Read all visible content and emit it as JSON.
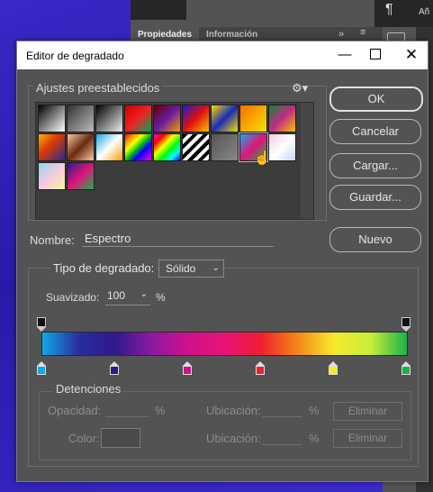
{
  "background": {
    "tabs": [
      "Propiedades",
      "Información"
    ],
    "collapse_icon": "»",
    "menu_icon": "≡",
    "pilcrow": "¶",
    "right_text": "Añ"
  },
  "dialog": {
    "title": "Editor de degradado",
    "window_controls": {
      "minimize": "—",
      "close": "✕"
    },
    "presets": {
      "label": "Ajustes preestablecidos",
      "gear_icon": "⚙▾",
      "swatches": [
        {
          "g": "linear-gradient(135deg,#000 0%,#fff 100%)"
        },
        {
          "g": "linear-gradient(135deg,#333 0%,#777 50%,#bbb 100%)"
        },
        {
          "g": "linear-gradient(135deg,#000 0%,#eee 100%)"
        },
        {
          "g": "linear-gradient(135deg,#c00 0%,#e22 50%,#0a5 100%)"
        },
        {
          "g": "linear-gradient(135deg,#600 0%,#6a1aa0 50%,#f6a000 100%)"
        },
        {
          "g": "linear-gradient(135deg,#1a1ac8 0%,#e01010 50%,#f6c400 100%)"
        },
        {
          "g": "linear-gradient(135deg,#f6e000 0%,#1a2ab8 50%,#f6e000 100%)"
        },
        {
          "g": "linear-gradient(135deg,#f67000 0%,#f6e000 100%)"
        },
        {
          "g": "linear-gradient(135deg,#0a8a2a 0%,#c02a8a 50%,#f6c400 100%)"
        },
        {
          "g": "linear-gradient(135deg,#f6b800 0%,#e03a00 40%,#2a2a8a 100%)"
        },
        {
          "g": "linear-gradient(135deg,#f6c8a0 0%,#6a2a10 50%,#f6c8a0 100%)"
        },
        {
          "g": "linear-gradient(135deg,#1aa8e8 0%,#fff 50%,#f6a000 100%)"
        },
        {
          "g": "linear-gradient(135deg,#f00 0%,#f80 16%,#ff0 33%,#0c0 50%,#00f 66%,#80f 83%,#f0f 100%)"
        },
        {
          "g": "linear-gradient(135deg,#f0f 0%,#f00 20%,#ff0 40%,#0f0 60%,#0ff 80%,#00f 100%)"
        },
        {
          "g": "repeating-linear-gradient(135deg,#000 0px,#000 4px,#fff 4px,#fff 8px)"
        },
        {
          "g": "linear-gradient(135deg,#555 0%,#888 100%)"
        },
        {
          "g": "linear-gradient(135deg,#1aa8e8 0%,#e01478 50%,#1ab24a 100%)"
        },
        {
          "g": "linear-gradient(135deg,#f6c8e0 0%,#fff 50%,#c8d8f6 100%)"
        },
        {
          "g": "linear-gradient(135deg,#8ad8f6 0%,#f6c8e0 50%,#f6f6a0 100%)"
        },
        {
          "g": "linear-gradient(135deg,#2a1a8a 0%,#e01478 50%,#1ab24a 100%)"
        }
      ]
    },
    "buttons": {
      "ok": "OK",
      "cancel": "Cancelar",
      "load": "Cargar...",
      "save": "Guardar...",
      "new": "Nuevo"
    },
    "name": {
      "label": "Nombre:",
      "value": "Espectro"
    },
    "gradient_type": {
      "label": "Tipo de degradado:",
      "value": "Sólido",
      "smoothness_label": "Suavizado:",
      "smoothness_value": "100",
      "smoothness_unit": "%",
      "opacity_stops": [
        0,
        100
      ],
      "color_stops": [
        {
          "pos": 0,
          "color": "#11a7e8"
        },
        {
          "pos": 20,
          "color": "#2e1a8a"
        },
        {
          "pos": 40,
          "color": "#d0108a"
        },
        {
          "pos": 60,
          "color": "#f01e30"
        },
        {
          "pos": 80,
          "color": "#f6ea2a"
        },
        {
          "pos": 100,
          "color": "#1ab24a"
        }
      ]
    },
    "stops": {
      "label": "Detenciones",
      "opacity_label": "Opacidad:",
      "opacity_unit": "%",
      "location_label": "Ubicación:",
      "location_unit": "%",
      "color_label": "Color:",
      "delete_label": "Eliminar"
    }
  }
}
